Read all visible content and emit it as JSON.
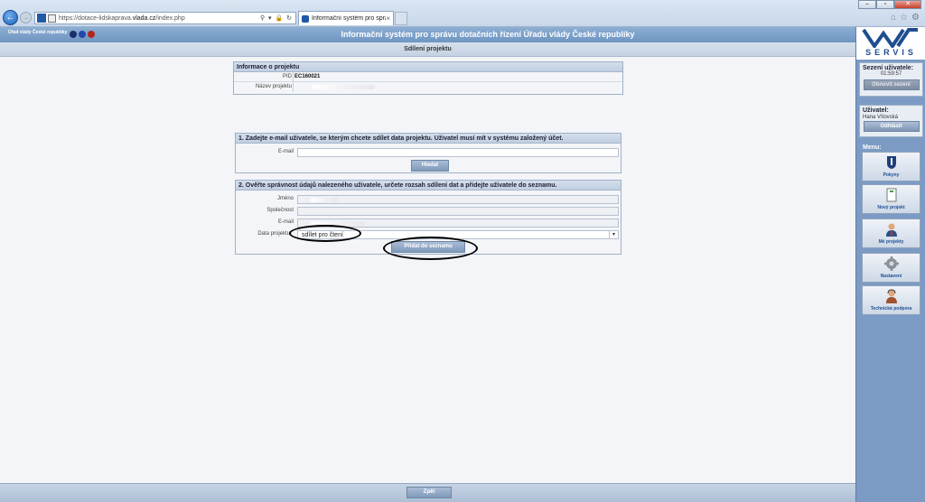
{
  "browser": {
    "url_prefix": "https://dotace-lidskaprava.",
    "url_domain": "vlada.cz",
    "url_suffix": "/index.php",
    "tab_title": "Informační systém pro sprá...",
    "tab_close": "×",
    "back": "←",
    "forward": "→",
    "addr_tools": "⚲ ▾ 🔒 ↻",
    "win_min": "–",
    "win_max": "▫",
    "win_close": "✕",
    "home": "⌂",
    "star": "☆",
    "gear": "⚙"
  },
  "header": {
    "gov_name": "Úřad vlády České republiky",
    "title": "Informační systém pro správu dotačních řízení Úřadu vlády České republiky",
    "subtitle": "Sdílení projektu"
  },
  "project_info": {
    "heading": "Informace o projektu",
    "pid_label": "PID",
    "pid_value": "EC160021",
    "name_label": "Název projektu"
  },
  "step1": {
    "heading": "1. Zadejte e-mail uživatele, se kterým chcete sdílet data projektu. Uživatel musí mít v systému založený účet.",
    "email_label": "E-mail",
    "search_button": "Hledat"
  },
  "step2": {
    "heading": "2. Ověřte správnost údajů nalezeného uživatele, určete rozsah sdílení dat a přidejte uživatele do seznamu.",
    "name_label": "Jméno",
    "company_label": "Společnost",
    "email_label": "E-mail",
    "data_label": "Data projektu",
    "data_select_value": "sdílet pro čtení",
    "add_button": "Přidat do seznamu"
  },
  "footer": {
    "back_button": "Zpět"
  },
  "sidebar": {
    "logo_text": "SERVIS",
    "session_title": "Sezení uživatele:",
    "session_time": "01:59:57",
    "renew_button": "Obnovit sezení",
    "user_title": "Uživatel:",
    "user_name": "Hana Vítovská",
    "logout_button": "Odhlásit",
    "menu_title": "Menu:",
    "menu": [
      {
        "label": "Pokyny",
        "icon": "info-icon"
      },
      {
        "label": "Nový projekt",
        "icon": "new-document-icon"
      },
      {
        "label": "Mé projekty",
        "icon": "user-icon"
      },
      {
        "label": "Nastavení",
        "icon": "gear-icon"
      },
      {
        "label": "Technická podpora",
        "icon": "support-icon"
      }
    ]
  }
}
